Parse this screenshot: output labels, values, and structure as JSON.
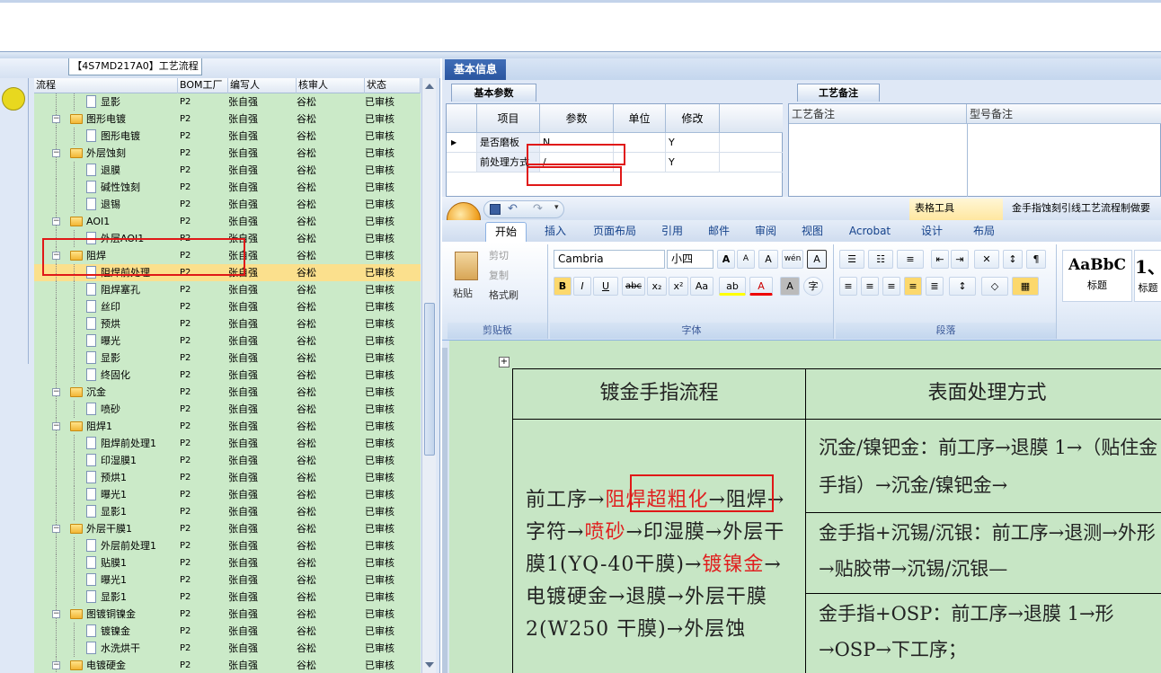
{
  "left_panel": {
    "tab_title": "【4S7MD217A0】工艺流程",
    "columns": [
      "流程",
      "BOM工厂",
      "编写人",
      "核审人",
      "状态"
    ],
    "rows": [
      {
        "name": "显影",
        "bom": "P2",
        "writer": "张自强",
        "reviewer": "谷松",
        "status": "已审核",
        "kind": "doc"
      },
      {
        "name": "图形电镀",
        "bom": "P2",
        "writer": "张自强",
        "reviewer": "谷松",
        "status": "已审核",
        "kind": "folder"
      },
      {
        "name": "图形电镀",
        "bom": "P2",
        "writer": "张自强",
        "reviewer": "谷松",
        "status": "已审核",
        "kind": "doc"
      },
      {
        "name": "外层蚀刻",
        "bom": "P2",
        "writer": "张自强",
        "reviewer": "谷松",
        "status": "已审核",
        "kind": "folder"
      },
      {
        "name": "退膜",
        "bom": "P2",
        "writer": "张自强",
        "reviewer": "谷松",
        "status": "已审核",
        "kind": "doc"
      },
      {
        "name": "碱性蚀刻",
        "bom": "P2",
        "writer": "张自强",
        "reviewer": "谷松",
        "status": "已审核",
        "kind": "doc"
      },
      {
        "name": "退锡",
        "bom": "P2",
        "writer": "张自强",
        "reviewer": "谷松",
        "status": "已审核",
        "kind": "doc"
      },
      {
        "name": "AOI1",
        "bom": "P2",
        "writer": "张自强",
        "reviewer": "谷松",
        "status": "已审核",
        "kind": "folder"
      },
      {
        "name": "外层AOI1",
        "bom": "P2",
        "writer": "张自强",
        "reviewer": "谷松",
        "status": "已审核",
        "kind": "doc"
      },
      {
        "name": "阻焊",
        "bom": "P2",
        "writer": "张自强",
        "reviewer": "谷松",
        "status": "已审核",
        "kind": "folder"
      },
      {
        "name": "阻焊前处理",
        "bom": "P2",
        "writer": "张自强",
        "reviewer": "谷松",
        "status": "已审核",
        "kind": "doc",
        "selected": true
      },
      {
        "name": "阻焊塞孔",
        "bom": "P2",
        "writer": "张自强",
        "reviewer": "谷松",
        "status": "已审核",
        "kind": "doc"
      },
      {
        "name": "丝印",
        "bom": "P2",
        "writer": "张自强",
        "reviewer": "谷松",
        "status": "已审核",
        "kind": "doc"
      },
      {
        "name": "预烘",
        "bom": "P2",
        "writer": "张自强",
        "reviewer": "谷松",
        "status": "已审核",
        "kind": "doc"
      },
      {
        "name": "曝光",
        "bom": "P2",
        "writer": "张自强",
        "reviewer": "谷松",
        "status": "已审核",
        "kind": "doc"
      },
      {
        "name": "显影",
        "bom": "P2",
        "writer": "张自强",
        "reviewer": "谷松",
        "status": "已审核",
        "kind": "doc"
      },
      {
        "name": "终固化",
        "bom": "P2",
        "writer": "张自强",
        "reviewer": "谷松",
        "status": "已审核",
        "kind": "doc"
      },
      {
        "name": "沉金",
        "bom": "P2",
        "writer": "张自强",
        "reviewer": "谷松",
        "status": "已审核",
        "kind": "folder"
      },
      {
        "name": "喷砂",
        "bom": "P2",
        "writer": "张自强",
        "reviewer": "谷松",
        "status": "已审核",
        "kind": "doc"
      },
      {
        "name": "阻焊1",
        "bom": "P2",
        "writer": "张自强",
        "reviewer": "谷松",
        "status": "已审核",
        "kind": "folder"
      },
      {
        "name": "阻焊前处理1",
        "bom": "P2",
        "writer": "张自强",
        "reviewer": "谷松",
        "status": "已审核",
        "kind": "doc"
      },
      {
        "name": "印湿膜1",
        "bom": "P2",
        "writer": "张自强",
        "reviewer": "谷松",
        "status": "已审核",
        "kind": "doc"
      },
      {
        "name": "预烘1",
        "bom": "P2",
        "writer": "张自强",
        "reviewer": "谷松",
        "status": "已审核",
        "kind": "doc"
      },
      {
        "name": "曝光1",
        "bom": "P2",
        "writer": "张自强",
        "reviewer": "谷松",
        "status": "已审核",
        "kind": "doc"
      },
      {
        "name": "显影1",
        "bom": "P2",
        "writer": "张自强",
        "reviewer": "谷松",
        "status": "已审核",
        "kind": "doc"
      },
      {
        "name": "外层干膜1",
        "bom": "P2",
        "writer": "张自强",
        "reviewer": "谷松",
        "status": "已审核",
        "kind": "folder"
      },
      {
        "name": "外层前处理1",
        "bom": "P2",
        "writer": "张自强",
        "reviewer": "谷松",
        "status": "已审核",
        "kind": "doc"
      },
      {
        "name": "贴膜1",
        "bom": "P2",
        "writer": "张自强",
        "reviewer": "谷松",
        "status": "已审核",
        "kind": "doc"
      },
      {
        "name": "曝光1",
        "bom": "P2",
        "writer": "张自强",
        "reviewer": "谷松",
        "status": "已审核",
        "kind": "doc"
      },
      {
        "name": "显影1",
        "bom": "P2",
        "writer": "张自强",
        "reviewer": "谷松",
        "status": "已审核",
        "kind": "doc"
      },
      {
        "name": "图镀铜镍金",
        "bom": "P2",
        "writer": "张自强",
        "reviewer": "谷松",
        "status": "已审核",
        "kind": "folder"
      },
      {
        "name": "镀镍金",
        "bom": "P2",
        "writer": "张自强",
        "reviewer": "谷松",
        "status": "已审核",
        "kind": "doc"
      },
      {
        "name": "水洗烘干",
        "bom": "P2",
        "writer": "张自强",
        "reviewer": "谷松",
        "status": "已审核",
        "kind": "doc"
      },
      {
        "name": "电镀硬金",
        "bom": "P2",
        "writer": "张自强",
        "reviewer": "谷松",
        "status": "已审核",
        "kind": "folder"
      }
    ]
  },
  "basic_info": {
    "tab_label": "基本信息",
    "params_tab": "基本参数",
    "params_headers": [
      "项目",
      "参数",
      "单位",
      "修改"
    ],
    "params_rows": [
      {
        "item": "是否磨板",
        "param": "N",
        "unit": "",
        "modify": "Y"
      },
      {
        "item": "前处理方式",
        "param": "/",
        "unit": "",
        "modify": "Y"
      }
    ],
    "notes_tab": "工艺备注",
    "notes_headers": [
      "工艺备注",
      "型号备注"
    ]
  },
  "word": {
    "table_tools": "表格工具",
    "doc_title": "金手指蚀刻引线工艺流程制做要",
    "tabs": [
      "开始",
      "插入",
      "页面布局",
      "引用",
      "邮件",
      "审阅",
      "视图",
      "Acrobat",
      "设计",
      "布局"
    ],
    "clipboard": {
      "paste": "粘贴",
      "cut": "剪切",
      "copy": "复制",
      "format_painter": "格式刷",
      "label": "剪贴板"
    },
    "font": {
      "name": "Cambria",
      "size": "小四",
      "label": "字体",
      "bold": "B",
      "italic": "I",
      "underline": "U",
      "strike": "abc",
      "sub": "x₂",
      "sup": "x²",
      "case": "Aa",
      "grow": "A",
      "shrink": "A",
      "clear": "A",
      "phonetic": "wén",
      "border": "A",
      "highlight": "ab",
      "color": "A",
      "charshade": "A",
      "enclose": "字"
    },
    "paragraph_label": "段落",
    "styles": [
      {
        "sample": "AaBbC",
        "name": "标题"
      },
      {
        "sample": "1、",
        "name": "标题"
      }
    ],
    "table": {
      "header_left": "镀金手指流程",
      "header_right": "表面处理方式",
      "left_body": [
        {
          "t": "前工序→"
        },
        {
          "t": "阻焊超粗化",
          "red": true
        },
        {
          "t": "→阻焊→字符→"
        },
        {
          "t": "喷砂",
          "red": true
        },
        {
          "t": "→印湿膜→外层干膜1(YQ-40干膜)→"
        },
        {
          "t": "镀镍金",
          "red": true
        },
        {
          "t": "→电镀硬金→退膜→外层干膜2(W250 干膜)→外层蚀"
        }
      ],
      "right_rows": [
        "沉金/镍钯金：前工序→退膜 1→（贴住金手指）→沉金/镍钯金→",
        "金手指+沉锡/沉银：前工序→退测→外形→贴胶带→沉锡/沉银—",
        "金手指+OSP：前工序→退膜 1→形→OSP→下工序；"
      ]
    }
  }
}
